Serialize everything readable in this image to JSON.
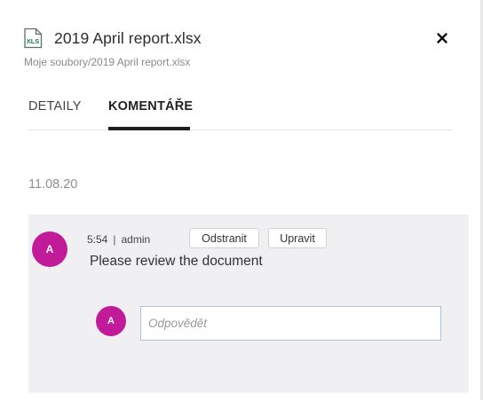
{
  "file": {
    "icon": "xlsx-file-icon",
    "icon_label": "XLS",
    "name": "2019 April report.xlsx",
    "path": "Moje soubory/2019 April report.xlsx"
  },
  "header": {
    "close_icon": "close-icon"
  },
  "tabs": [
    {
      "label": "DETAILY",
      "active": false
    },
    {
      "label": "KOMENTÁŘE",
      "active": true
    }
  ],
  "comments": {
    "date": "11.08.20",
    "items": [
      {
        "avatar": "A",
        "time": "5:54",
        "separator": "|",
        "author": "admin",
        "delete_label": "Odstranit",
        "edit_label": "Upravit",
        "text": "Please review the document"
      }
    ],
    "reply": {
      "avatar": "A",
      "placeholder": "Odpovědět",
      "value": ""
    }
  },
  "colors": {
    "avatar": "#c11b9a",
    "xls_green": "#1e7d45",
    "comment_bg": "#f0f0f2",
    "input_border": "#a9c3e0"
  }
}
